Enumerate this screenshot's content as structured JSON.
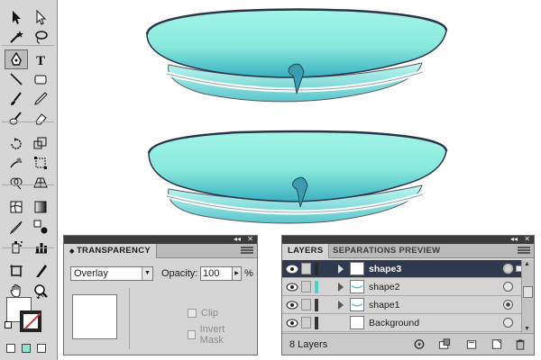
{
  "toolbox": {
    "tools": [
      {
        "name": "selection-tool"
      },
      {
        "name": "direct-selection-tool"
      },
      {
        "name": "magic-wand-tool"
      },
      {
        "name": "lasso-tool"
      },
      {
        "name": "pen-tool",
        "selected": true
      },
      {
        "name": "type-tool",
        "glyph": "T"
      },
      {
        "name": "line-segment-tool"
      },
      {
        "name": "rectangle-tool"
      },
      {
        "name": "paintbrush-tool"
      },
      {
        "name": "pencil-tool"
      },
      {
        "name": "blob-brush-tool"
      },
      {
        "name": "eraser-tool"
      },
      {
        "name": "rotate-tool"
      },
      {
        "name": "scale-tool"
      },
      {
        "name": "warp-tool"
      },
      {
        "name": "free-transform-tool"
      },
      {
        "name": "shape-builder-tool"
      },
      {
        "name": "perspective-grid-tool"
      },
      {
        "name": "mesh-tool"
      },
      {
        "name": "gradient-tool"
      },
      {
        "name": "eyedropper-tool"
      },
      {
        "name": "blend-tool"
      },
      {
        "name": "symbol-sprayer-tool"
      },
      {
        "name": "column-graph-tool"
      },
      {
        "name": "artboard-tool"
      },
      {
        "name": "slice-tool"
      },
      {
        "name": "hand-tool"
      },
      {
        "name": "zoom-tool"
      }
    ],
    "fill_color": "#ffffff",
    "stroke_color": "#222222"
  },
  "canvas": {
    "shape_fill_top": "#a2f5e6",
    "shape_fill_bottom": "#3ab0c0",
    "outline_color": "#2a3348"
  },
  "transparency_panel": {
    "title": "TRANSPARENCY",
    "blend_mode": "Overlay",
    "opacity_label": "Opacity:",
    "opacity_value": "100",
    "opacity_unit": "%",
    "clip_label": "Clip",
    "invert_mask_label": "Invert Mask"
  },
  "layers_panel": {
    "tabs": [
      "LAYERS",
      "SEPARATIONS PREVIEW"
    ],
    "layers": [
      {
        "name": "shape3",
        "selected": true,
        "color": "#2b2b2b",
        "target": "ring"
      },
      {
        "name": "shape2",
        "selected": false,
        "color": "#4bd1c4",
        "target": "empty"
      },
      {
        "name": "shape1",
        "selected": false,
        "color": "#3a3a3a",
        "target": "filled"
      },
      {
        "name": "Background",
        "selected": false,
        "color": "#333333",
        "target": "empty"
      }
    ],
    "layer_count": "8 Layers"
  }
}
